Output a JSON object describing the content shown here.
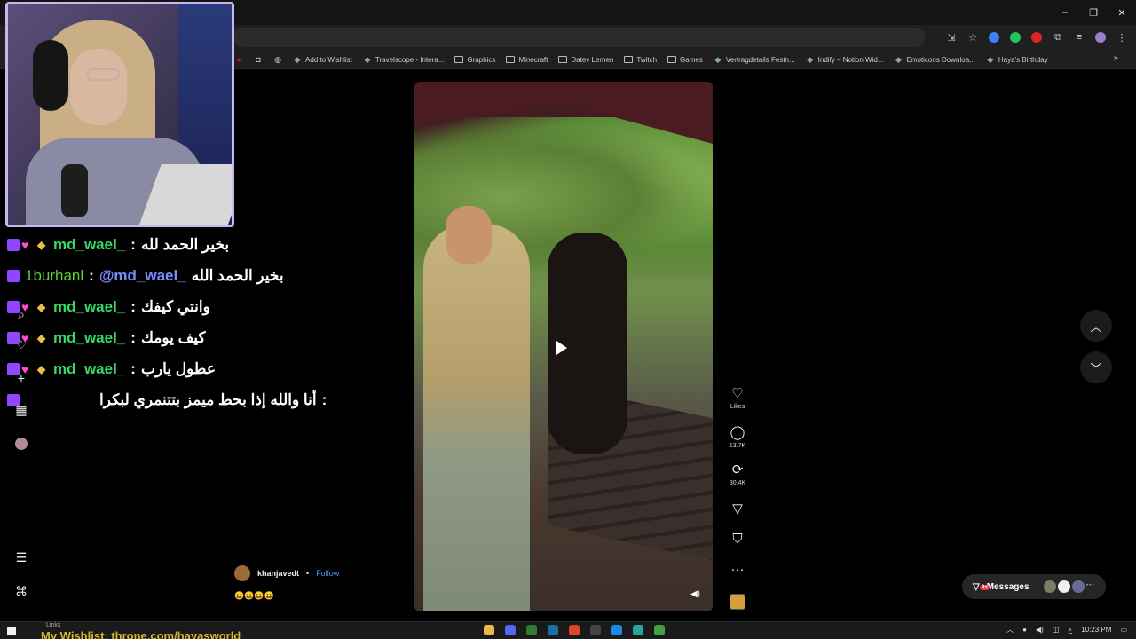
{
  "bookmarks": [
    {
      "label": "Add to Wishlist",
      "kind": "page"
    },
    {
      "label": "Travelscope - Intera...",
      "kind": "page"
    },
    {
      "label": "Graphics",
      "kind": "folder"
    },
    {
      "label": "Minecraft",
      "kind": "folder"
    },
    {
      "label": "Datev Lernen",
      "kind": "folder"
    },
    {
      "label": "Twitch",
      "kind": "folder"
    },
    {
      "label": "Games",
      "kind": "folder"
    },
    {
      "label": "Vertragdetails Festn...",
      "kind": "page"
    },
    {
      "label": "Indify – Notion Wid...",
      "kind": "page"
    },
    {
      "label": "Emoticons Downloa...",
      "kind": "page"
    },
    {
      "label": "Haya's Birthday",
      "kind": "page"
    }
  ],
  "chat": [
    {
      "user": "md_wael_",
      "message": "بخير الحمد لله",
      "mention": ""
    },
    {
      "user": "1burhanl",
      "message": "بخير الحمد الله",
      "mention": "@md_wael_"
    },
    {
      "user": "md_wael_",
      "message": "وانتي كيفك",
      "mention": ""
    },
    {
      "user": "md_wael_",
      "message": "كيف يومك",
      "mention": ""
    },
    {
      "user": "md_wael_",
      "message": "عطول يارب",
      "mention": ""
    },
    {
      "user": "",
      "message": "أنا والله إذا بحط ميمز بتتنمري لبكرا",
      "mention": ""
    }
  ],
  "post": {
    "author": "khanjavedt",
    "separator": "•",
    "follow_label": "Follow",
    "caption": "😀😀😀😀",
    "likes_label": "Likes",
    "comments_count": "13.7K",
    "reposts_count": "30.4K"
  },
  "messages": {
    "label": "Messages",
    "badge": "9+"
  },
  "taskbar": {
    "ticker": "My Wishlist: throne.com/hayasworld",
    "links_label": "Links",
    "lang": "ع",
    "time": "10:23 PM"
  },
  "colors": {
    "webcam_border": "#c8b6ee",
    "username_green": "#37d86a",
    "mention_blue": "#7a8cff",
    "follow_blue": "#4d9bff",
    "ticker_gold": "#d8b82a",
    "badge_red": "#ff3040"
  }
}
